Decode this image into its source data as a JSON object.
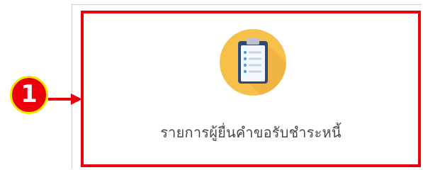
{
  "callout": {
    "step_number": "1"
  },
  "menu": {
    "item_label": "รายการผู้ยื่นคำขอรับชำระหนี้",
    "item_icon": "clipboard-list-icon"
  },
  "colors": {
    "highlight_border": "#e8000b",
    "badge_fill": "#e8000b",
    "badge_ring": "#f5e600",
    "icon_circle": "#f7c04a",
    "clipboard_board": "#2e4a72",
    "label_text": "#4a4a4a"
  }
}
